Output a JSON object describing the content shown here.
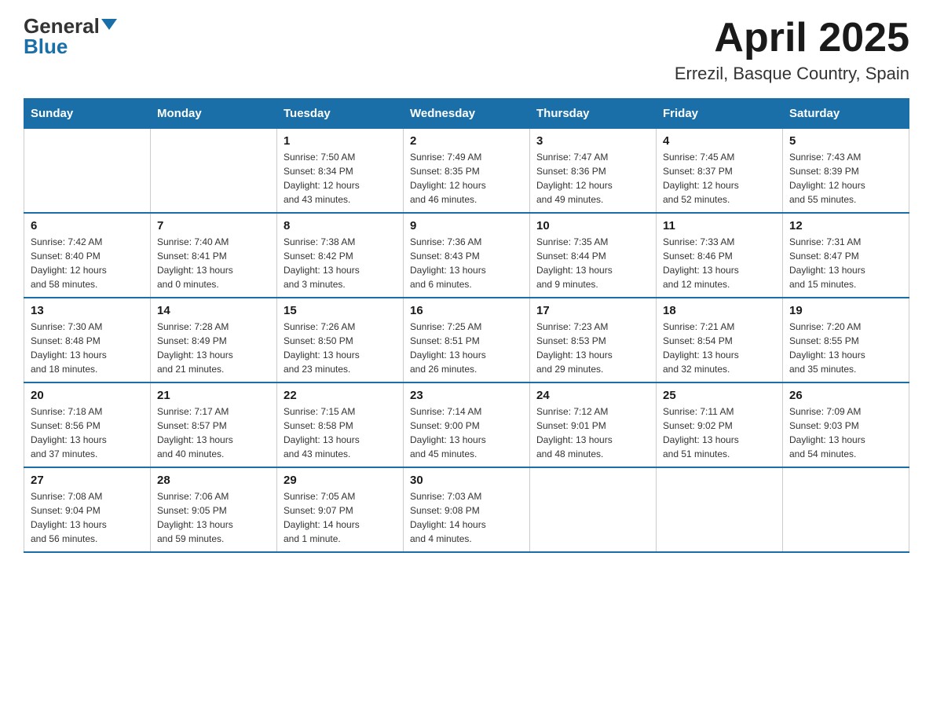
{
  "logo": {
    "general": "General",
    "blue": "Blue"
  },
  "title": {
    "month_year": "April 2025",
    "location": "Errezil, Basque Country, Spain"
  },
  "headers": [
    "Sunday",
    "Monday",
    "Tuesday",
    "Wednesday",
    "Thursday",
    "Friday",
    "Saturday"
  ],
  "weeks": [
    [
      {
        "day": "",
        "info": ""
      },
      {
        "day": "",
        "info": ""
      },
      {
        "day": "1",
        "info": "Sunrise: 7:50 AM\nSunset: 8:34 PM\nDaylight: 12 hours\nand 43 minutes."
      },
      {
        "day": "2",
        "info": "Sunrise: 7:49 AM\nSunset: 8:35 PM\nDaylight: 12 hours\nand 46 minutes."
      },
      {
        "day": "3",
        "info": "Sunrise: 7:47 AM\nSunset: 8:36 PM\nDaylight: 12 hours\nand 49 minutes."
      },
      {
        "day": "4",
        "info": "Sunrise: 7:45 AM\nSunset: 8:37 PM\nDaylight: 12 hours\nand 52 minutes."
      },
      {
        "day": "5",
        "info": "Sunrise: 7:43 AM\nSunset: 8:39 PM\nDaylight: 12 hours\nand 55 minutes."
      }
    ],
    [
      {
        "day": "6",
        "info": "Sunrise: 7:42 AM\nSunset: 8:40 PM\nDaylight: 12 hours\nand 58 minutes."
      },
      {
        "day": "7",
        "info": "Sunrise: 7:40 AM\nSunset: 8:41 PM\nDaylight: 13 hours\nand 0 minutes."
      },
      {
        "day": "8",
        "info": "Sunrise: 7:38 AM\nSunset: 8:42 PM\nDaylight: 13 hours\nand 3 minutes."
      },
      {
        "day": "9",
        "info": "Sunrise: 7:36 AM\nSunset: 8:43 PM\nDaylight: 13 hours\nand 6 minutes."
      },
      {
        "day": "10",
        "info": "Sunrise: 7:35 AM\nSunset: 8:44 PM\nDaylight: 13 hours\nand 9 minutes."
      },
      {
        "day": "11",
        "info": "Sunrise: 7:33 AM\nSunset: 8:46 PM\nDaylight: 13 hours\nand 12 minutes."
      },
      {
        "day": "12",
        "info": "Sunrise: 7:31 AM\nSunset: 8:47 PM\nDaylight: 13 hours\nand 15 minutes."
      }
    ],
    [
      {
        "day": "13",
        "info": "Sunrise: 7:30 AM\nSunset: 8:48 PM\nDaylight: 13 hours\nand 18 minutes."
      },
      {
        "day": "14",
        "info": "Sunrise: 7:28 AM\nSunset: 8:49 PM\nDaylight: 13 hours\nand 21 minutes."
      },
      {
        "day": "15",
        "info": "Sunrise: 7:26 AM\nSunset: 8:50 PM\nDaylight: 13 hours\nand 23 minutes."
      },
      {
        "day": "16",
        "info": "Sunrise: 7:25 AM\nSunset: 8:51 PM\nDaylight: 13 hours\nand 26 minutes."
      },
      {
        "day": "17",
        "info": "Sunrise: 7:23 AM\nSunset: 8:53 PM\nDaylight: 13 hours\nand 29 minutes."
      },
      {
        "day": "18",
        "info": "Sunrise: 7:21 AM\nSunset: 8:54 PM\nDaylight: 13 hours\nand 32 minutes."
      },
      {
        "day": "19",
        "info": "Sunrise: 7:20 AM\nSunset: 8:55 PM\nDaylight: 13 hours\nand 35 minutes."
      }
    ],
    [
      {
        "day": "20",
        "info": "Sunrise: 7:18 AM\nSunset: 8:56 PM\nDaylight: 13 hours\nand 37 minutes."
      },
      {
        "day": "21",
        "info": "Sunrise: 7:17 AM\nSunset: 8:57 PM\nDaylight: 13 hours\nand 40 minutes."
      },
      {
        "day": "22",
        "info": "Sunrise: 7:15 AM\nSunset: 8:58 PM\nDaylight: 13 hours\nand 43 minutes."
      },
      {
        "day": "23",
        "info": "Sunrise: 7:14 AM\nSunset: 9:00 PM\nDaylight: 13 hours\nand 45 minutes."
      },
      {
        "day": "24",
        "info": "Sunrise: 7:12 AM\nSunset: 9:01 PM\nDaylight: 13 hours\nand 48 minutes."
      },
      {
        "day": "25",
        "info": "Sunrise: 7:11 AM\nSunset: 9:02 PM\nDaylight: 13 hours\nand 51 minutes."
      },
      {
        "day": "26",
        "info": "Sunrise: 7:09 AM\nSunset: 9:03 PM\nDaylight: 13 hours\nand 54 minutes."
      }
    ],
    [
      {
        "day": "27",
        "info": "Sunrise: 7:08 AM\nSunset: 9:04 PM\nDaylight: 13 hours\nand 56 minutes."
      },
      {
        "day": "28",
        "info": "Sunrise: 7:06 AM\nSunset: 9:05 PM\nDaylight: 13 hours\nand 59 minutes."
      },
      {
        "day": "29",
        "info": "Sunrise: 7:05 AM\nSunset: 9:07 PM\nDaylight: 14 hours\nand 1 minute."
      },
      {
        "day": "30",
        "info": "Sunrise: 7:03 AM\nSunset: 9:08 PM\nDaylight: 14 hours\nand 4 minutes."
      },
      {
        "day": "",
        "info": ""
      },
      {
        "day": "",
        "info": ""
      },
      {
        "day": "",
        "info": ""
      }
    ]
  ]
}
